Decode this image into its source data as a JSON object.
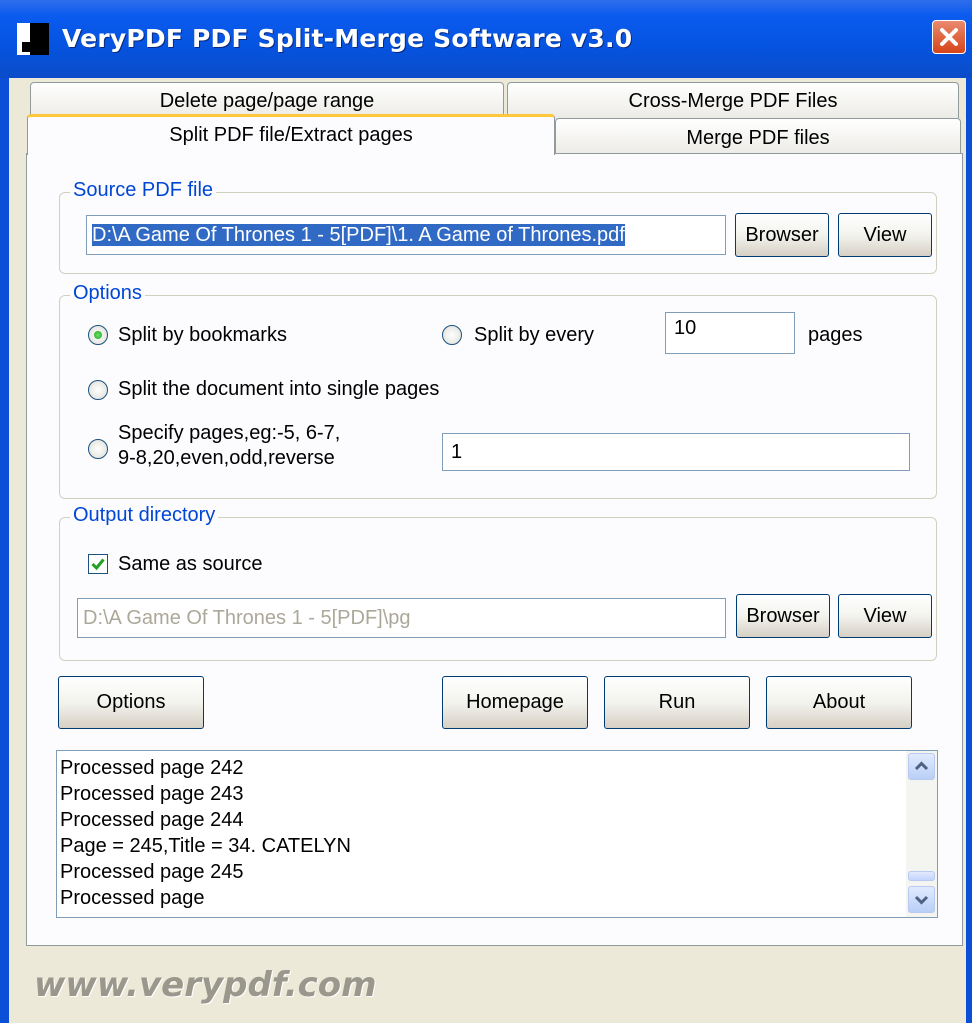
{
  "window": {
    "title": "VeryPDF PDF Split-Merge Software v3.0"
  },
  "tabs": [
    {
      "label": "Delete page/page range",
      "active": false
    },
    {
      "label": "Cross-Merge PDF Files",
      "active": false
    },
    {
      "label": "Split PDF file/Extract pages",
      "active": true
    },
    {
      "label": "Merge PDF files",
      "active": false
    }
  ],
  "source": {
    "legend": "Source PDF file",
    "path": "D:\\A Game Of Thrones 1 - 5[PDF]\\1. A Game of Thrones.pdf",
    "browse_label": "Browser",
    "view_label": "View"
  },
  "options": {
    "legend": "Options",
    "split_by_bookmarks": "Split by bookmarks",
    "split_by_every": "Split by every",
    "every_value": "10",
    "pages_label": "pages",
    "single_pages": "Split the document into single pages",
    "specify_line1": "Specify pages,eg:-5, 6-7,",
    "specify_line2": "9-8,20,even,odd,reverse",
    "specify_value": "1",
    "selected": "split_by_bookmarks"
  },
  "output": {
    "legend": "Output directory",
    "same_as_source": "Same as source",
    "same_checked": true,
    "path": "D:\\A Game Of Thrones 1 - 5[PDF]\\pg",
    "browse_label": "Browser",
    "view_label": "View"
  },
  "buttons": {
    "options": "Options",
    "homepage": "Homepage",
    "run": "Run",
    "about": "About"
  },
  "log": [
    "Processed page 242",
    "Processed page 243",
    "Processed page 244",
    "Page = 245,Title = 34. CATELYN",
    "Processed page 245",
    "Processed page"
  ],
  "footer": {
    "text": "www.verypdf.com"
  },
  "colors": {
    "titlebar": "#0A5BEF",
    "legend": "#0046D5",
    "active_tab_accent": "#FFC83C",
    "window_bg": "#ECE9D8"
  }
}
